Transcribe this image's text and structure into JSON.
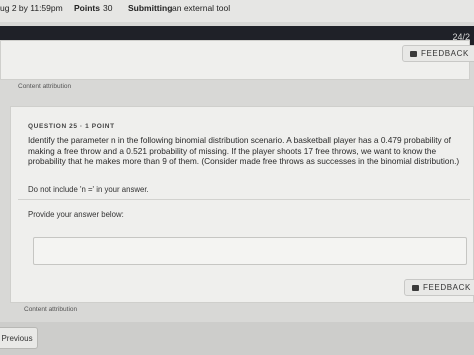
{
  "topbar": {
    "due": "ug 2 by 11:59pm",
    "points_label": "Points",
    "points_value": "30",
    "submitting_label": "Submitting",
    "submitting_value": "an external tool"
  },
  "progress": "24/2",
  "feedback_label": "FEEDBACK",
  "content_attribution": "Content attribution",
  "question": {
    "header": "QUESTION 25 · 1 POINT",
    "text": "Identify the parameter n in the following binomial distribution scenario. A basketball player has a 0.479 probability of making a free throw and a 0.521 probability of missing. If the player shoots 17 free throws, we want to know the probability that he makes more than 9 of them. (Consider made free throws as successes in the binomial distribution.)",
    "note": "Do not include 'n =' in your answer.",
    "prompt": "Provide your answer below:",
    "answer_value": ""
  },
  "nav": {
    "previous": "Previous"
  }
}
